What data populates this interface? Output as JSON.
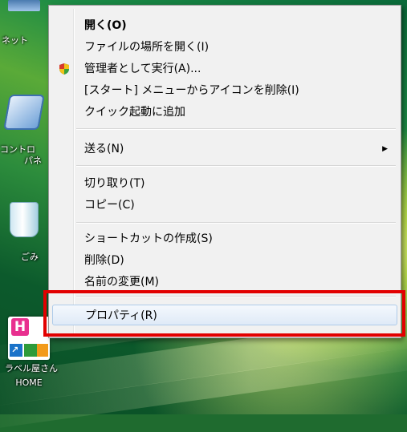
{
  "desktop": {
    "icons": [
      {
        "label": "ネット"
      },
      {
        "label1": "コントロ",
        "label2": "パネ"
      },
      {
        "label": "ごみ"
      },
      {
        "label1": "ラベル屋さん",
        "label2": "HOME"
      }
    ]
  },
  "context_menu": {
    "items": [
      {
        "label": "開く(O)",
        "bold": true
      },
      {
        "label": "ファイルの場所を開く(I)"
      },
      {
        "label": "管理者として実行(A)...",
        "icon": "uac-shield-icon"
      },
      {
        "label": "[スタート] メニューからアイコンを削除(I)"
      },
      {
        "label": "クイック起動に追加"
      },
      {
        "label": "送る(N)",
        "submenu_arrow": "▶"
      },
      {
        "label": "切り取り(T)"
      },
      {
        "label": "コピー(C)"
      },
      {
        "label": "ショートカットの作成(S)"
      },
      {
        "label": "削除(D)"
      },
      {
        "label": "名前の変更(M)"
      },
      {
        "label": "プロパティ(R)",
        "highlighted": true
      }
    ]
  },
  "colors": {
    "annotation": "#e20000",
    "menu_background": "#f1f1f1",
    "highlight_border": "#aecbe9"
  }
}
